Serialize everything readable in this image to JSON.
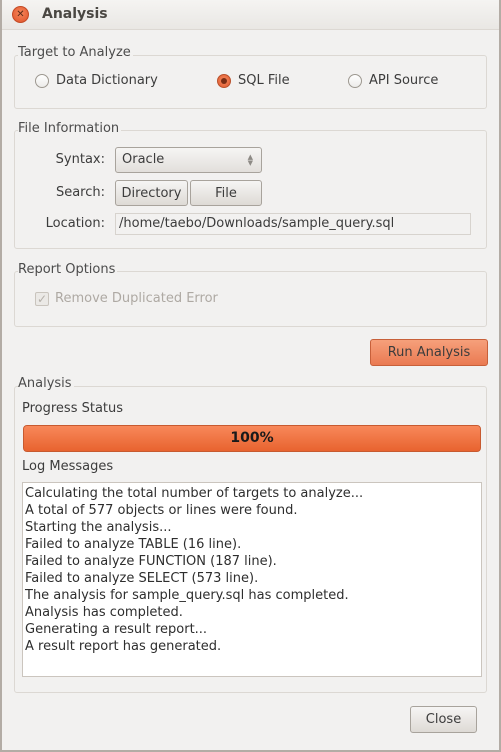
{
  "window": {
    "title": "Analysis",
    "close_icon": "close-x-icon"
  },
  "target": {
    "group_label": "Target to Analyze",
    "options": [
      {
        "label": "Data Dictionary",
        "checked": false
      },
      {
        "label": "SQL File",
        "checked": true
      },
      {
        "label": "API Source",
        "checked": false
      }
    ]
  },
  "file_info": {
    "group_label": "File Information",
    "syntax_label": "Syntax:",
    "syntax_value": "Oracle",
    "search_label": "Search:",
    "directory_button": "Directory",
    "file_button": "File",
    "location_label": "Location:",
    "location_value": "/home/taebo/Downloads/sample_query.sql"
  },
  "report_options": {
    "group_label": "Report Options",
    "remove_duplicated_label": "Remove Duplicated Error",
    "remove_duplicated_checked": true,
    "remove_duplicated_enabled": false
  },
  "run_button": "Run Analysis",
  "analysis": {
    "group_label": "Analysis",
    "progress_label": "Progress Status",
    "progress_percent": 100,
    "progress_text": "100%",
    "log_label": "Log Messages",
    "log_lines": [
      "Calculating the total number of targets to analyze...",
      "A total of 577 objects or lines were found.",
      "Starting the analysis...",
      "Failed to analyze TABLE (16 line).",
      "Failed to analyze FUNCTION (187 line).",
      "Failed to analyze SELECT (573 line).",
      "The analysis for sample_query.sql has completed.",
      "Analysis has completed.",
      "Generating a result report...",
      "A result report has generated."
    ]
  },
  "close_button": "Close",
  "colors": {
    "accent": "#e8632f",
    "window_bg": "#f2f1f0"
  }
}
